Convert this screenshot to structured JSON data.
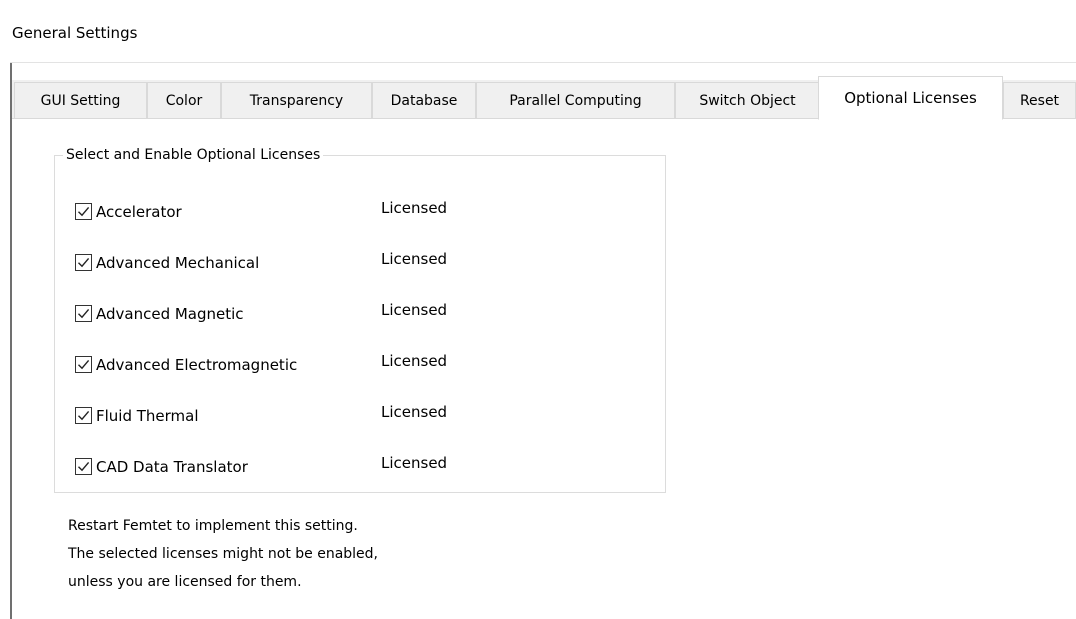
{
  "window": {
    "title": "General Settings"
  },
  "tabs": [
    {
      "label": "GUI Setting",
      "active": false
    },
    {
      "label": "Color",
      "active": false
    },
    {
      "label": "Transparency",
      "active": false
    },
    {
      "label": "Database",
      "active": false
    },
    {
      "label": "Parallel Computing",
      "active": false
    },
    {
      "label": "Switch Object",
      "active": false
    },
    {
      "label": "Optional Licenses",
      "active": true
    },
    {
      "label": "Reset",
      "active": false
    }
  ],
  "group": {
    "legend": "Select and Enable Optional Licenses",
    "options": [
      {
        "label": "Accelerator",
        "status": "Licensed",
        "checked": true
      },
      {
        "label": "Advanced Mechanical",
        "status": "Licensed",
        "checked": true
      },
      {
        "label": "Advanced Magnetic",
        "status": "Licensed",
        "checked": true
      },
      {
        "label": "Advanced Electromagnetic",
        "status": "Licensed",
        "checked": true
      },
      {
        "label": "Fluid Thermal",
        "status": "Licensed",
        "checked": true
      },
      {
        "label": "CAD Data Translator",
        "status": "Licensed",
        "checked": true
      }
    ]
  },
  "notes": [
    "Restart Femtet to implement this setting.",
    "The selected licenses might not be enabled,",
    "unless you are licensed for them."
  ],
  "colors": {
    "active_tab_bg": "#ffffff",
    "inactive_tab_bg": "#f0f0f0",
    "border": "#d9d9d9",
    "checkbox_border": "#333333"
  },
  "icons": {
    "checkbox": "checkmark-icon"
  }
}
